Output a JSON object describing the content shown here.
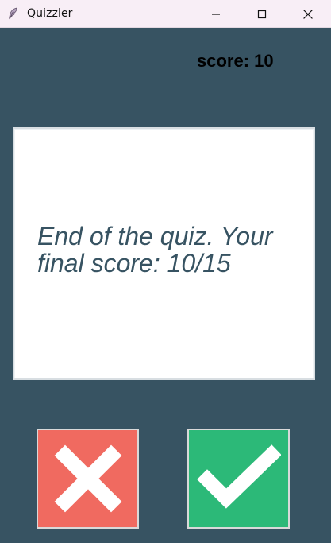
{
  "window": {
    "title": "Quizzler",
    "icon": "feather-icon",
    "controls": [
      "minimize-icon",
      "maximize-icon",
      "close-icon"
    ]
  },
  "score": {
    "label": "score: 10"
  },
  "question": {
    "text": "End of the quiz. Your final score: 10/15"
  },
  "answers": {
    "false_icon": "x-icon",
    "true_icon": "check-icon"
  },
  "colors": {
    "background": "#375362",
    "card": "#FFFFFF",
    "question_text": "#375362",
    "false_button": "#F06A60",
    "true_button": "#2CB978",
    "titlebar": "#F8EEF6"
  }
}
